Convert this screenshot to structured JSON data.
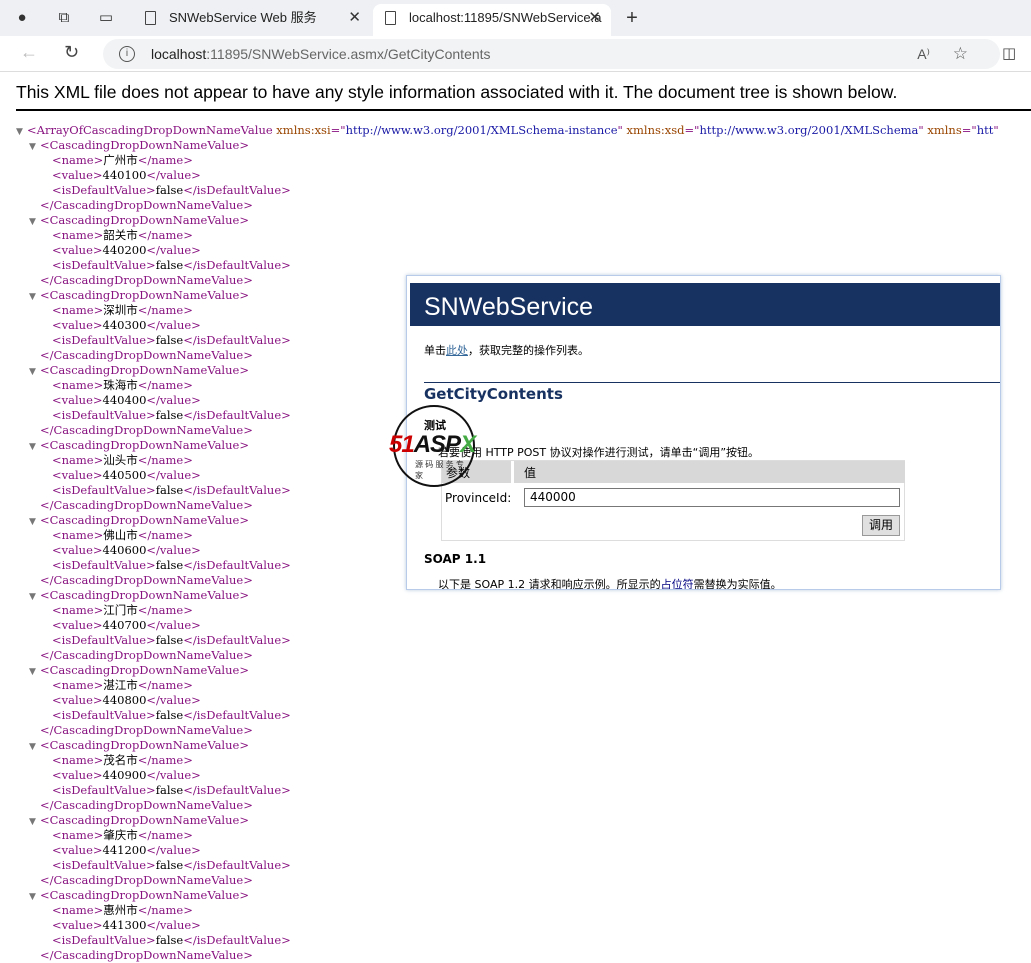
{
  "browser": {
    "tabs": [
      {
        "label": "SNWebService Web 服务"
      },
      {
        "label": "localhost:11895/SNWebService.a"
      }
    ],
    "url_host": "localhost",
    "url_rest": ":11895/SNWebService.asmx/GetCityContents"
  },
  "banner": "This XML file does not appear to have any style information associated with it. The document tree is shown below.",
  "xml": {
    "root_tag": "ArrayOfCascadingDropDownNameValue",
    "attrs": [
      {
        "name": "xmlns:xsi",
        "value": "http://www.w3.org/2001/XMLSchema-instance"
      },
      {
        "name": "xmlns:xsd",
        "value": "http://www.w3.org/2001/XMLSchema"
      },
      {
        "name": "xmlns",
        "value": "htt"
      }
    ],
    "item_tag": "CascadingDropDownNameValue",
    "items": [
      {
        "name": "广州市",
        "value": "440100",
        "isDefaultValue": "false"
      },
      {
        "name": "韶关市",
        "value": "440200",
        "isDefaultValue": "false"
      },
      {
        "name": "深圳市",
        "value": "440300",
        "isDefaultValue": "false"
      },
      {
        "name": "珠海市",
        "value": "440400",
        "isDefaultValue": "false"
      },
      {
        "name": "汕头市",
        "value": "440500",
        "isDefaultValue": "false"
      },
      {
        "name": "佛山市",
        "value": "440600",
        "isDefaultValue": "false"
      },
      {
        "name": "江门市",
        "value": "440700",
        "isDefaultValue": "false"
      },
      {
        "name": "湛江市",
        "value": "440800",
        "isDefaultValue": "false"
      },
      {
        "name": "茂名市",
        "value": "440900",
        "isDefaultValue": "false"
      },
      {
        "name": "肇庆市",
        "value": "441200",
        "isDefaultValue": "false"
      },
      {
        "name": "惠州市",
        "value": "441300",
        "isDefaultValue": "false"
      }
    ]
  },
  "popup": {
    "title": "SNWebService",
    "intro_prefix": "单击",
    "intro_link": "此处",
    "intro_suffix": "，获取完整的操作列表。",
    "op_title": "GetCityContents",
    "test_heading": "测试",
    "test_desc": "若要使用 HTTP POST 协议对操作进行测试，请单击“调用”按钮。",
    "col_param": "参数",
    "col_value": "值",
    "param_label": "ProvinceId:",
    "param_value": "440000",
    "invoke_label": "调用",
    "soap_heading": "SOAP 1.1",
    "soap_prefix": "以下是 SOAP 1.2 请求和响应示例。所显示的",
    "soap_link": "占位符",
    "soap_suffix": "需替换为实际值。"
  },
  "watermark": {
    "text": "51ASPX",
    "sub": "源码服务专家"
  }
}
